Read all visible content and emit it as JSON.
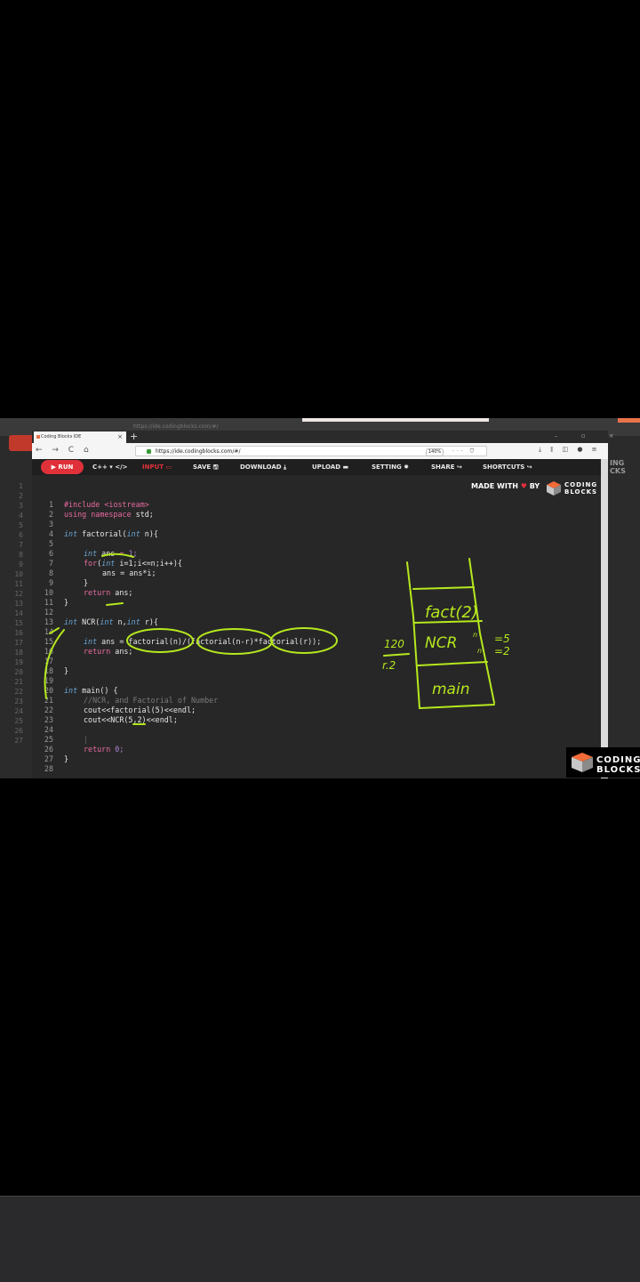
{
  "outer_browser": {
    "url": "https://ide.codingblocks.com/#/"
  },
  "browser": {
    "tab_title": "Coding Blocks IDE",
    "tab_close": "×",
    "new_tab": "+",
    "window_controls": "– ▫ ×",
    "nav_icons": "← → C ⌂",
    "url": "https://ide.codingblocks.com/#/",
    "zoom": "140%",
    "url_actions": "··· ⛉ ☆",
    "toolbar_right": "⤓ ⫴ ◫ ● ≡"
  },
  "ide": {
    "toolbar": {
      "run": "▶ RUN",
      "language": "C++ ▾ </>",
      "input": "INPUT ▭",
      "save": "SAVE 🖫",
      "download": "DOWNLOAD ⤓",
      "upload": "UPLOAD ▬",
      "setting": "SETTING ✹",
      "share": "SHARE ↪",
      "shortcuts": "SHORTCUTS ↪"
    },
    "made_with": "MADE WITH",
    "heart": "♥",
    "by": "BY",
    "brand_line1": "CODING",
    "brand_line2": "BLOCKS",
    "code": {
      "l1_num": "1",
      "l1": "#include <iostream>",
      "l2_num": "2",
      "l2_a": "using namespace",
      "l2_b": " std;",
      "l3_num": "3",
      "l4_num": "4",
      "l4_a": "int",
      "l4_b": " factorial(",
      "l4_c": "int",
      "l4_d": " n){",
      "l5_num": "5",
      "l6_num": "6",
      "l6_a": "int",
      "l6_b": " ans ",
      "l6_c": "=",
      "l6_d": " 1;",
      "l7_num": "7",
      "l7_a": "for",
      "l7_b": "(",
      "l7_c": "int",
      "l7_d": " i=1;i<=n;i++){",
      "l8_num": "8",
      "l8": "ans = ans*i;",
      "l9_num": "9",
      "l9": "}",
      "l10_num": "10",
      "l10_a": "return",
      "l10_b": " ans;",
      "l11_num": "11",
      "l11": "}",
      "l12_num": "12",
      "l13_num": "13",
      "l13_a": "int",
      "l13_b": " NCR(",
      "l13_c": "int",
      "l13_d": " n,",
      "l13_e": "int",
      "l13_f": " r){",
      "l14_num": "14",
      "l15_num": "15",
      "l15_a": "int",
      "l15_b": " ans = factorial(n)/(factorial(n-r)*factorial(r));",
      "l16_num": "16",
      "l16_a": "return",
      "l16_b": " ans;",
      "l17_num": "17",
      "l18_num": "18",
      "l18": "}",
      "l19_num": "19",
      "l20_num": "20",
      "l20_a": "int",
      "l20_b": " main() {",
      "l21_num": "21",
      "l21": "//NCR, and Factorial of Number",
      "l22_num": "22",
      "l22": "cout<<factorial(5)<<endl;",
      "l23_num": "23",
      "l23": "cout<<NCR(5,2)<<endl;",
      "l24_num": "24",
      "l25_num": "25",
      "l25": "|",
      "l26_num": "26",
      "l26_a": "return",
      "l26_b": " 0;",
      "l27_num": "27",
      "l27": "}",
      "l28_num": "28"
    }
  },
  "annotations": {
    "stack_top": "fact(2)",
    "stack_mid": "NCR",
    "stack_bottom": "main",
    "n_eq": "=5",
    "r_eq": "=2",
    "n_sup": "n",
    "r_sub": "n",
    "left_120": "120",
    "left_r2": "r.2"
  },
  "bg_line_numbers": [
    "1",
    "2",
    "3",
    "4",
    "5",
    "6",
    "7",
    "8",
    "9",
    "10",
    "11",
    "12",
    "13",
    "14",
    "15",
    "16",
    "17",
    "18",
    "19",
    "20",
    "21",
    "22",
    "23",
    "24",
    "25",
    "26",
    "27"
  ],
  "bg_brand": "ING\nCKS"
}
